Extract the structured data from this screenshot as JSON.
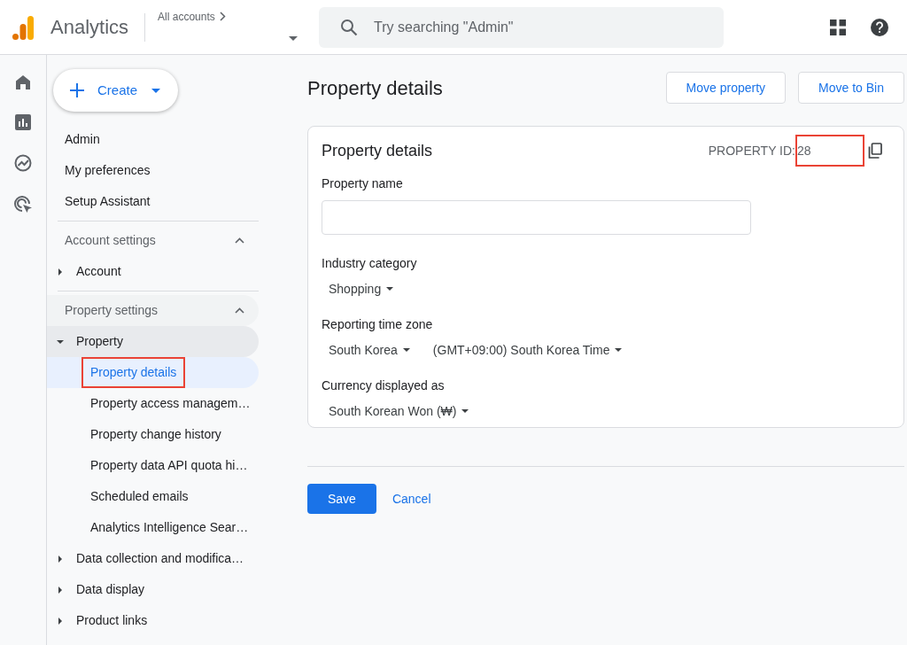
{
  "app": {
    "name": "Analytics",
    "breadcrumb": "All accounts"
  },
  "search": {
    "placeholder": "Try searching \"Admin\""
  },
  "create_button": {
    "label": "Create"
  },
  "nav": [
    {
      "kind": "link",
      "label": "Admin"
    },
    {
      "kind": "link",
      "label": "My preferences"
    },
    {
      "kind": "link",
      "label": "Setup Assistant"
    },
    {
      "kind": "section",
      "label": "Account settings",
      "expanded": true,
      "children": [
        {
          "kind": "group",
          "label": "Account",
          "expanded": false
        }
      ]
    },
    {
      "kind": "section",
      "label": "Property settings",
      "expanded": true,
      "children": [
        {
          "kind": "group",
          "label": "Property",
          "expanded": true,
          "children": [
            {
              "label": "Property details",
              "selected": true,
              "highlighted": true
            },
            {
              "label": "Property access managem…",
              "selected": false,
              "highlighted": false
            },
            {
              "label": "Property change history",
              "selected": false,
              "highlighted": false
            },
            {
              "label": "Property data API quota hi…",
              "selected": false,
              "highlighted": false
            },
            {
              "label": "Scheduled emails",
              "selected": false,
              "highlighted": false
            },
            {
              "label": "Analytics Intelligence Sear…",
              "selected": false,
              "highlighted": false
            }
          ]
        },
        {
          "kind": "group",
          "label": "Data collection and modifica…",
          "expanded": false
        },
        {
          "kind": "group",
          "label": "Data display",
          "expanded": false
        },
        {
          "kind": "group",
          "label": "Product links",
          "expanded": false
        }
      ]
    }
  ],
  "page": {
    "title": "Property details",
    "actions": [
      "Move property",
      "Move to Bin"
    ]
  },
  "card": {
    "title": "Property details",
    "property_id_label": "PROPERTY ID:",
    "property_id": "28",
    "id_highlighted": true,
    "fields": [
      {
        "kind": "text",
        "label": "Property name"
      },
      {
        "kind": "select",
        "label": "Industry category",
        "values": [
          "Shopping"
        ]
      },
      {
        "kind": "select",
        "label": "Reporting time zone",
        "values": [
          "South Korea",
          "(GMT+09:00) South Korea Time"
        ]
      },
      {
        "kind": "select",
        "label": "Currency displayed as",
        "values": [
          "South Korean Won (₩)"
        ]
      }
    ]
  },
  "footer": {
    "buttons": [
      {
        "kind": "primary",
        "label": "Save"
      },
      {
        "kind": "text",
        "label": "Cancel"
      }
    ]
  }
}
